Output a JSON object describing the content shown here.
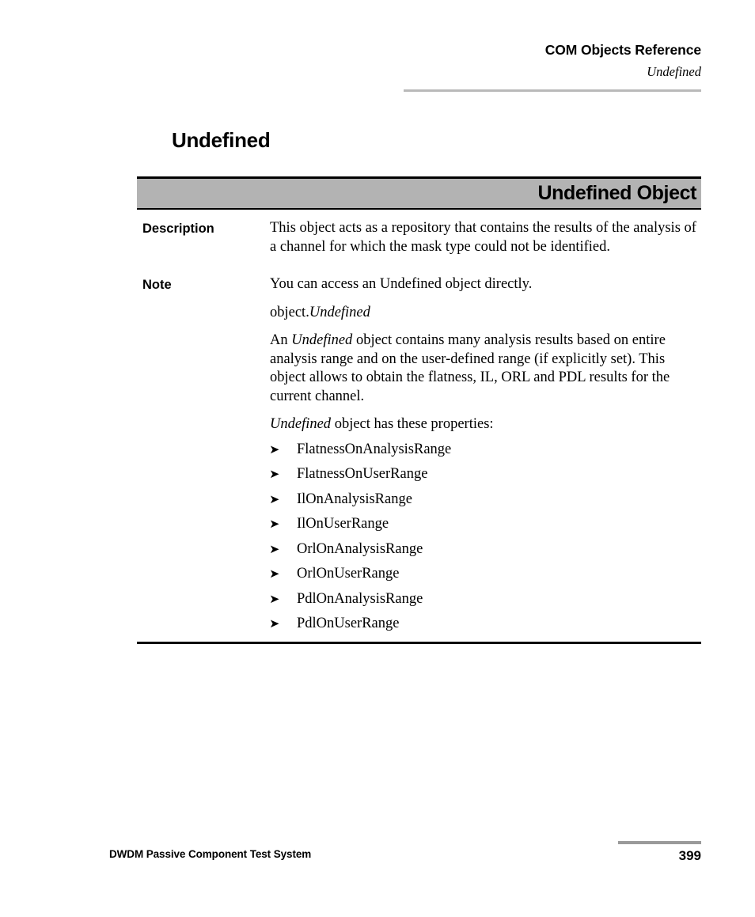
{
  "header": {
    "title": "COM Objects Reference",
    "subtitle": "Undefined"
  },
  "chapter": {
    "title": "Undefined"
  },
  "object_table": {
    "bar_title": "Undefined Object",
    "bar_color": "#b3b3b3",
    "rows": [
      {
        "label": "Description",
        "paragraphs": [
          "This object acts as a repository that contains the results of the analysis of a channel for which the mask type could not be identified."
        ]
      },
      {
        "label": "Note",
        "paragraphs": [
          "You can access an Undefined object directly.",
          "object.Undefined",
          "An Undefined object contains many analysis results based on entire analysis range and on the user-defined range (if explicitly set). This object allows to obtain the flatness, IL, ORL and PDL results for the current channel.",
          "Undefined object has these properties:"
        ]
      }
    ]
  },
  "note_text": {
    "line1": "You can access an Undefined object directly.",
    "line2_roman": "object.",
    "line2_italic": "Undefined",
    "para3_a": "An ",
    "para3_italic": "Undefined",
    "para3_b": " object contains many analysis results based on entire analysis range and on the user-defined range (if explicitly set). This object allows to obtain the flatness, IL, ORL and PDL results for the current channel.",
    "para4_italic": "Undefined",
    "para4_rest": " object has these properties:"
  },
  "properties": {
    "bullet_glyph": "➤",
    "items": [
      "FlatnessOnAnalysisRange",
      "FlatnessOnUserRange",
      "IlOnAnalysisRange",
      "IlOnUserRange",
      "OrlOnAnalysisRange",
      "OrlOnUserRange",
      "PdlOnAnalysisRange",
      "PdlOnUserRange"
    ]
  },
  "footer": {
    "product": "DWDM Passive Component Test System",
    "page_number": "399"
  }
}
